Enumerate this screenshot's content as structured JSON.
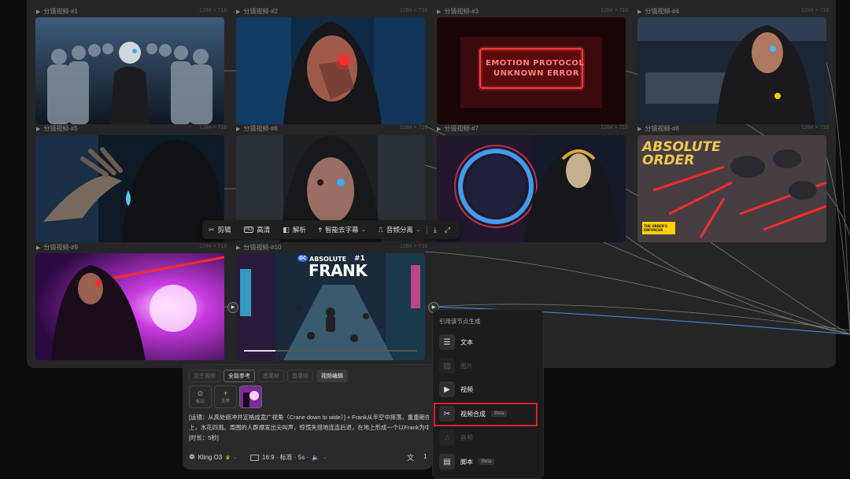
{
  "thumbnails": [
    {
      "label": "分镜视频-#1",
      "size": "1284 × 716"
    },
    {
      "label": "分镜视频-#2",
      "size": "1284 × 716"
    },
    {
      "label": "分镜视频-#3",
      "size": "1284 × 716"
    },
    {
      "label": "分镜视频-#4",
      "size": "1284 × 716"
    },
    {
      "label": "分镜视频-#5",
      "size": "1284 × 716"
    },
    {
      "label": "分镜视频-#6",
      "size": "1284 × 716"
    },
    {
      "label": "分镜视频-#7",
      "size": "1284 × 716"
    },
    {
      "label": "分镜视频-#8",
      "size": "1284 × 716"
    },
    {
      "label": "分镜视频-#9",
      "size": "1284 × 716"
    },
    {
      "label": "分镜视频-#10",
      "size": "1284 × 716"
    }
  ],
  "image_text": {
    "t3_line1": "EMOTION PROTOCOL",
    "t3_line2": "UNKNOWN ERROR",
    "t8_line1": "ABSOLUTE",
    "t8_line2": "ORDER",
    "t8_badge": "THE ORDER'S ENFORCER",
    "t10_dc": "DC",
    "t10_line1": "ABSOLUTE",
    "t10_num": "#1",
    "t10_line2": "FRANK"
  },
  "toolbar": {
    "cut": "剪辑",
    "hd": "高清",
    "hd_icon": "HD",
    "analyze": "解析",
    "subtitle_remove": "智能去字幕",
    "audio_split": "音频分离"
  },
  "editor": {
    "tabs": [
      "文生视频",
      "全能参考",
      "首尾帧",
      "首尾帧",
      "视频编辑"
    ],
    "ref_mark": "标记",
    "ref_subject": "主体",
    "prompt_line1": "[运镜：从高处俯冲并定格成宽广视角（Crane down to wide）] + Frank从半空中摔落，重重砸在",
    "prompt_line2": "上，水花四溅。周围的人群爆发出尖叫声，惊慌失措地连连后退，在地上形成一个以Frank为中心",
    "prompt_line3": "[时长：5秒]",
    "model": "Kling O3",
    "settings": "16:9 · 标准 · 5s ·",
    "count": "1"
  },
  "menu": {
    "title": "引用该节点生成",
    "items": [
      {
        "label": "文本",
        "icon": "text-lines-icon",
        "enabled": true
      },
      {
        "label": "图片",
        "icon": "image-icon",
        "enabled": false
      },
      {
        "label": "视频",
        "icon": "video-icon",
        "enabled": true
      },
      {
        "label": "视频合成",
        "icon": "scissors-icon",
        "enabled": true,
        "badge": "Beta"
      },
      {
        "label": "音频",
        "icon": "audio-icon",
        "enabled": false
      },
      {
        "label": "脚本",
        "icon": "script-icon",
        "enabled": true,
        "badge": "Beta"
      }
    ]
  },
  "colors": {
    "highlight": "#e02020",
    "accent_red": "#ff2a2a",
    "accent_blue": "#2a8cff"
  }
}
